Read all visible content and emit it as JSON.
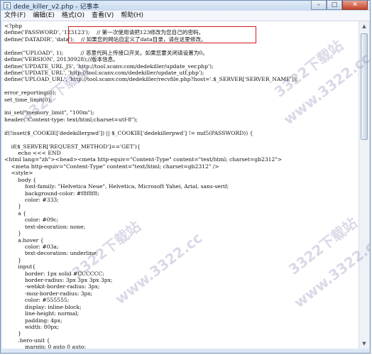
{
  "window": {
    "title": "dede_killer_v2.php - 记事本",
    "minimize_glyph": "–",
    "maximize_glyph": "□",
    "close_glyph": "✕"
  },
  "menu": [
    "文件(F)",
    "编辑(E)",
    "格式(O)",
    "查看(V)",
    "帮助(H)"
  ],
  "editor": {
    "lines": [
      "<?php",
      "define('PASSWORD', '123123');    // 第一次使用请把123修改为您自己的密码。",
      "define('DATADIR', 'data');    // 如果您的网站自定义了data目录，请在这里修改。",
      "",
      "define(\"UPLOAD\", 1);          // 恶意代码上传接口开关。如果您要关闭请设置为0。",
      "define('VERSION', 20130928);//版本信息。",
      "define('UPDATE_URL_JS', 'http://tool.scanv.com/dedekiller/update_ver.php');",
      "define('UPDATE_URL', 'http://tool.scanv.com/dedekiller/update_utf.php');",
      "define('UPLOAD_URL', 'http://tool.scanv.com/dedekiller/recvfile.php?host='.$_SERVER['SERVER_NAME']);",
      "",
      "error_reporting(0);",
      "set_time_limit(0);",
      "",
      "ini_set(\"memory_limit\", \"100m\");",
      "header(\"Content-type: text/html;charset=utf-8\");",
      "",
      "if(!isset($_COOKIE['dedekillerpwd']) || $_COOKIE['dedekillerpwd'] != md5(PASSWORD)) {",
      "",
      "    if($_SERVER['REQUEST_METHOD']=='GET'){",
      "        echo <<< END",
      "<html lang=\"zh\"><head><meta http-equiv=\"Content-Type\" content=\"text/html; charset=gb2312\">",
      "    <meta http-equiv=\"Content-Type\" content=\"text/html; charset=gb2312\" />",
      "    <style>",
      "        body {",
      "            font-family: \"Helvetica Neue\", Helvetica, Microsoft Yahei, Arial, sans-serif;",
      "            background-color: #f8f8f8;",
      "            color: #333;",
      "        }",
      "        a {",
      "            color: #09c;",
      "            text-decoration: none;",
      "        }",
      "        a:hover {",
      "            color: #03a;",
      "            text-decoration: underline;",
      "        }",
      "        input{",
      "            border: 1px solid #CCCCCC;",
      "            border-radius: 3px 3px 3px 3px;",
      "            -webkit-border-radius: 3px;",
      "            -moz-border-radius: 3px;",
      "            color: #555555;",
      "            display: inline-block;",
      "            line-height: normal;",
      "            padding: 4px;",
      "            width: 80px;",
      "        }",
      "        .hero-unit {",
      "            margin: 0 auto 0 auto;"
    ]
  },
  "watermark": {
    "domain": "www.3322.cc",
    "site_name": "3322下载站"
  }
}
